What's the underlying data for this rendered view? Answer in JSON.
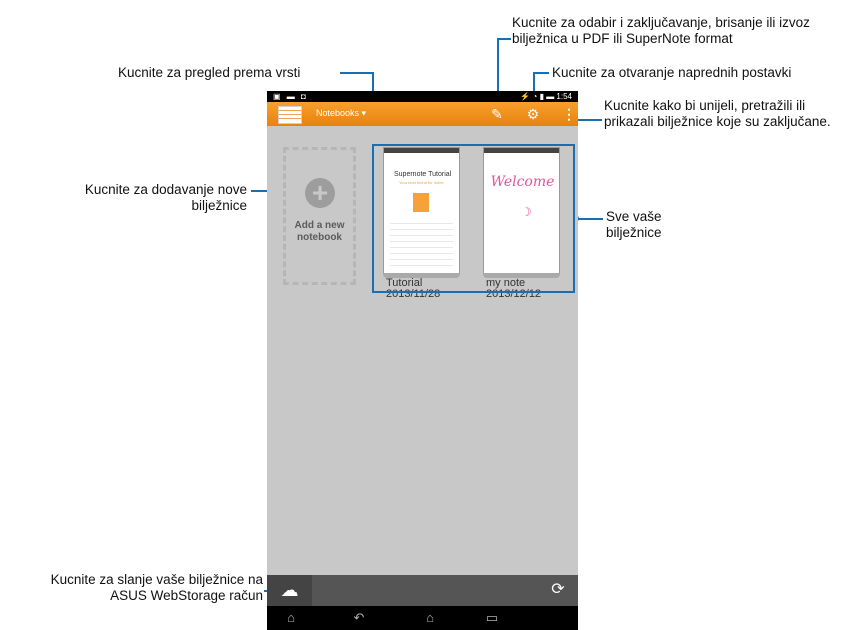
{
  "callouts": {
    "view_type": "Kucnite za pregled prema vrsti",
    "select_line1": "Kucnite za odabir i zaključavanje, brisanje ili izvoz",
    "select_line2": "bilježnica u PDF ili SuperNote format",
    "settings": "Kucnite za otvaranje naprednih postavki",
    "menu_line1": "Kucnite kako bi unijeli, pretražili ili",
    "menu_line2": "prikazali bilježnice koje su zaključane.",
    "add_line1": "Kucnite za dodavanje nove",
    "add_line2": "bilježnice",
    "all_line1": "Sve vaše",
    "all_line2": "bilježnice",
    "upload_line1": "Kucnite za slanje vaše bilježnice na",
    "upload_line2": "ASUS WebStorage račun"
  },
  "statusbar": {
    "left_icons": "▣ ▬ ◘",
    "right": "⚡ ◔ ▮ ▬ 1:54"
  },
  "actionbar": {
    "title": "Notebooks ▾"
  },
  "add_card": {
    "label_line1": "Add a new",
    "label_line2": "notebook"
  },
  "notebooks": [
    {
      "name": "Tutorial",
      "date": "2013/11/28",
      "heading": "Supernote Tutorial",
      "sub": "Your best friend for notes"
    },
    {
      "name": "my note",
      "date": "2013/12/12",
      "heading": "Welcome",
      "sub": "☽"
    }
  ],
  "icons": [
    "notebook-icon",
    "dropdown-icon",
    "select-edit-icon",
    "settings-gear-icon",
    "overflow-menu-icon",
    "add-plus-icon",
    "cloud-settings-icon",
    "sync-icon",
    "home-icon",
    "back-icon",
    "recent-apps-icon"
  ],
  "colors": {
    "accent_orange": "#f39a24",
    "callout_blue": "#1a6fb3",
    "content_gray": "#c8c8c8"
  }
}
